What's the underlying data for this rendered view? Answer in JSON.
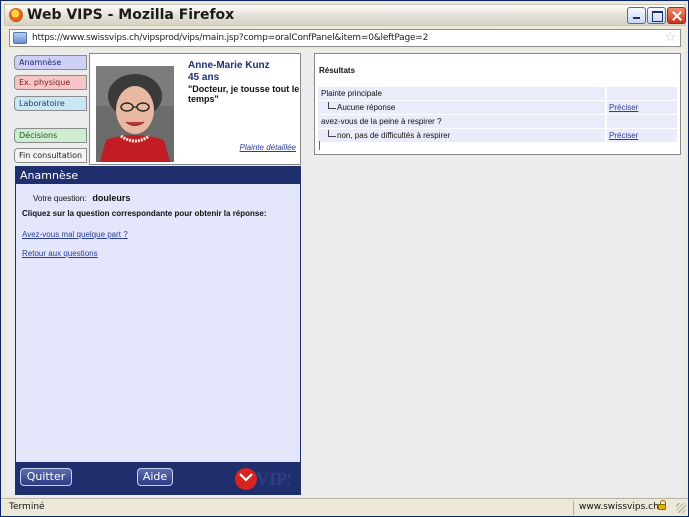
{
  "window": {
    "title": "Web VIPS - Mozilla Firefox",
    "url": "https://www.swissvips.ch/vipsprod/vips/main.jsp?comp=oralConfPanel&item=0&leftPage=2"
  },
  "tabs": {
    "anamnese": "Anamnèse",
    "examen": "Ex. physique",
    "laboratoire": "Laboratoire",
    "decisions": "Décisions",
    "fin": "Fin consultation"
  },
  "patient": {
    "name": "Anne-Marie Kunz",
    "age": "45 ans",
    "quote": "\"Docteur, je tousse tout le temps\"",
    "complaint_link": "Plainte détaillée"
  },
  "panel": {
    "header": "Anamnèse",
    "question_label": "Votre question:",
    "question_value": "douleurs",
    "instruction": "Cliquez sur la question correspondante pour obtenir la réponse:",
    "links": [
      "Avez-vous mal quelque part ?",
      "Retour aux questions"
    ],
    "quit_button": "Quitter",
    "help_button": "Aide",
    "logo": "VIPS"
  },
  "results": {
    "title": "Résultats",
    "rows": [
      {
        "text": "Plainte principale",
        "action": ""
      },
      {
        "text": "Aucune réponse",
        "action": "Préciser"
      },
      {
        "text": "avez-vous de la peine à respirer ?",
        "action": ""
      },
      {
        "text": "non, pas de difficultés à respirer",
        "action": "Préciser"
      }
    ]
  },
  "status": {
    "left": "Terminé",
    "right": "www.swissvips.ch"
  },
  "colors": {
    "panel_navy": "#1f2f6e",
    "panel_bg": "#e4e6fb",
    "link_blue": "#2a3d9a",
    "logo_red": "#d8241f"
  }
}
